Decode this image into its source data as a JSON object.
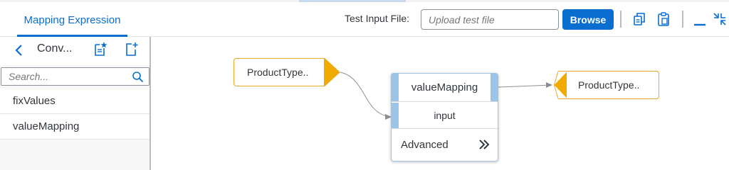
{
  "header": {
    "tab_label": "Mapping Expression",
    "test_input_label": "Test Input File:",
    "upload_placeholder": "Upload test file",
    "browse_label": "Browse"
  },
  "sidebar": {
    "title": "Conv...",
    "search_placeholder": "Search...",
    "items": [
      {
        "label": "fixValues"
      },
      {
        "label": "valueMapping"
      }
    ]
  },
  "canvas": {
    "source_node": {
      "label": "ProductType.."
    },
    "function_node": {
      "title": "valueMapping",
      "input_label": "input",
      "advanced_label": "Advanced"
    },
    "target_node": {
      "label": "ProductType.."
    }
  },
  "colors": {
    "accent": "#0a6ed1",
    "node_border": "#e9a825",
    "node_arrow": "#f0ab00",
    "function_strip": "#9cc3e8"
  },
  "icons": {
    "toolbar": [
      "copy-icon",
      "paste-icon",
      "minimize-icon",
      "exit-fullscreen-icon"
    ],
    "sidebar": [
      "back-icon",
      "favorite-document-icon",
      "add-document-icon",
      "search-icon"
    ]
  }
}
